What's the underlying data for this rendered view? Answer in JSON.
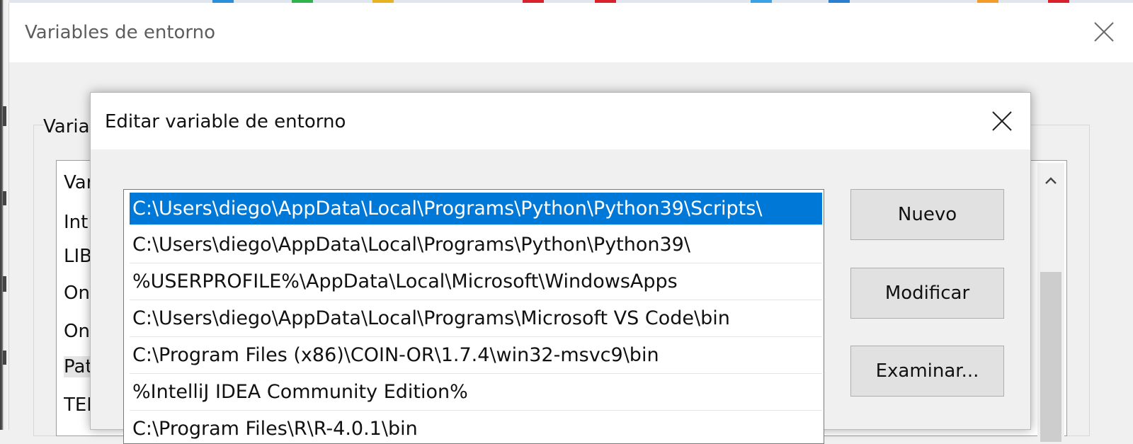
{
  "outer_dialog": {
    "title": "Variables de entorno",
    "group_label": "Varia",
    "list_items": [
      "Var",
      "Int",
      "LIB",
      "On",
      "On",
      "Pat",
      "TEI"
    ]
  },
  "inner_dialog": {
    "title": "Editar variable de entorno",
    "paths": [
      "C:\\Users\\diego\\AppData\\Local\\Programs\\Python\\Python39\\Scripts\\",
      "C:\\Users\\diego\\AppData\\Local\\Programs\\Python\\Python39\\",
      "%USERPROFILE%\\AppData\\Local\\Microsoft\\WindowsApps",
      "C:\\Users\\diego\\AppData\\Local\\Programs\\Microsoft VS Code\\bin",
      "C:\\Program Files (x86)\\COIN-OR\\1.7.4\\win32-msvc9\\bin",
      "%IntelliJ IDEA Community Edition%",
      "C:\\Program Files\\R\\R-4.0.1\\bin"
    ],
    "buttons": {
      "new": "Nuevo",
      "edit": "Modificar",
      "browse": "Examinar..."
    }
  },
  "colors": {
    "selection": "#0078d7",
    "button_bg": "#e1e1e1",
    "dialog_bg": "#f0f0f0"
  },
  "icons": {
    "close": "close-icon",
    "scroll_up": "chevron-up-icon"
  }
}
